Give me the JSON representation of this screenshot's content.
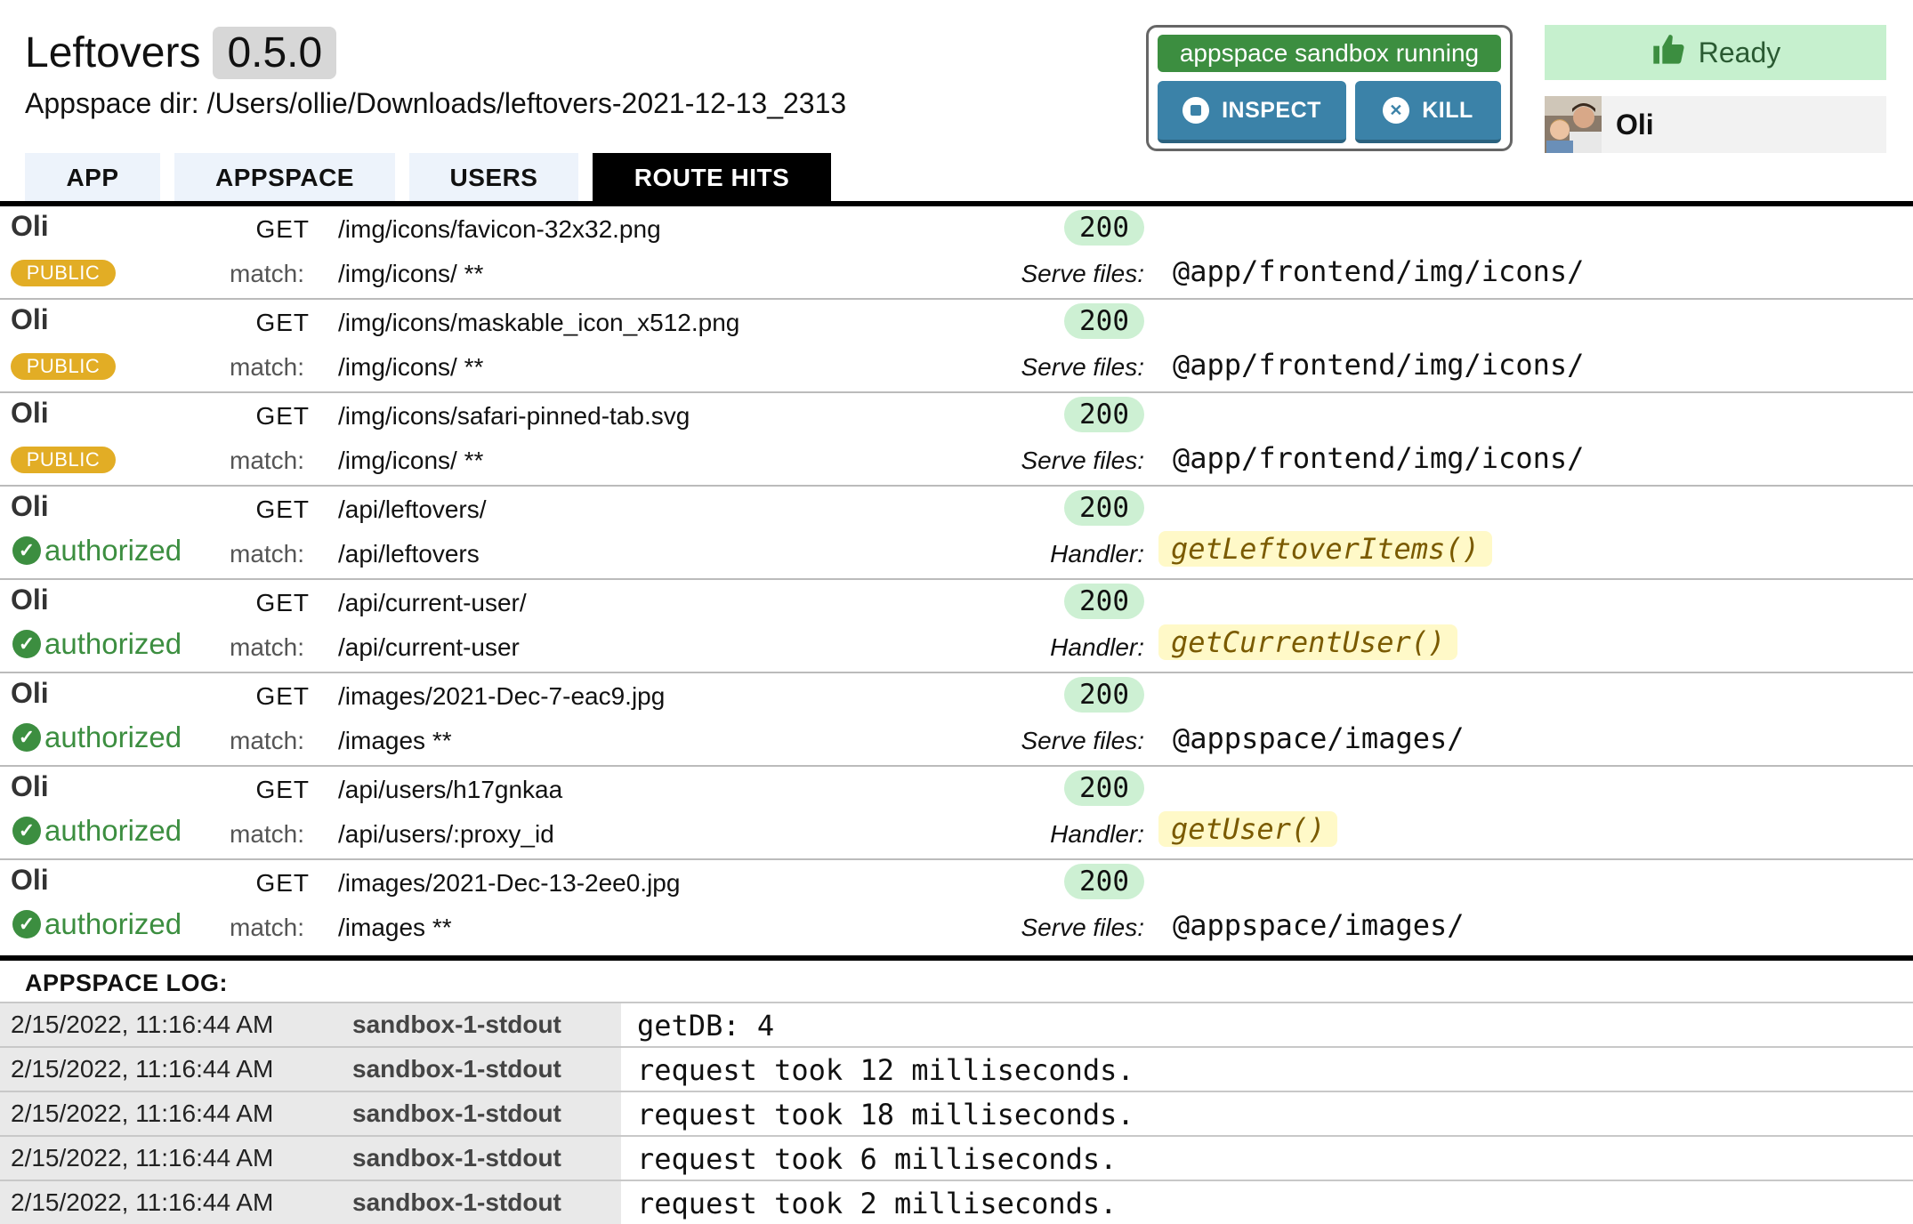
{
  "header": {
    "app_name": "Leftovers",
    "version": "0.5.0",
    "appspace_dir": "Appspace dir: /Users/ollie/Downloads/leftovers-2021-12-13_2313"
  },
  "sandbox": {
    "status": "appspace sandbox running",
    "inspect_label": "INSPECT",
    "kill_label": "KILL"
  },
  "ready": {
    "label": "Ready"
  },
  "user": {
    "name": "Oli"
  },
  "tabs": [
    {
      "label": "APP",
      "active": false
    },
    {
      "label": "APPSPACE",
      "active": false
    },
    {
      "label": "USERS",
      "active": false
    },
    {
      "label": "ROUTE HITS",
      "active": true
    }
  ],
  "route_hits": [
    {
      "user": "Oli",
      "method": "GET",
      "path": "/img/icons/favicon-32x32.png",
      "status": "200",
      "auth": "PUBLIC",
      "match_label": "match:",
      "match": "/img/icons/ **",
      "target_label": "Serve files:",
      "target": "@app/frontend/img/icons/"
    },
    {
      "user": "Oli",
      "method": "GET",
      "path": "/img/icons/maskable_icon_x512.png",
      "status": "200",
      "auth": "PUBLIC",
      "match_label": "match:",
      "match": "/img/icons/ **",
      "target_label": "Serve files:",
      "target": "@app/frontend/img/icons/"
    },
    {
      "user": "Oli",
      "method": "GET",
      "path": "/img/icons/safari-pinned-tab.svg",
      "status": "200",
      "auth": "PUBLIC",
      "match_label": "match:",
      "match": "/img/icons/ **",
      "target_label": "Serve files:",
      "target": "@app/frontend/img/icons/"
    },
    {
      "user": "Oli",
      "method": "GET",
      "path": "/api/leftovers/",
      "status": "200",
      "auth": "authorized",
      "match_label": "match:",
      "match": "/api/leftovers",
      "target_label": "Handler:",
      "target": "getLeftoverItems()"
    },
    {
      "user": "Oli",
      "method": "GET",
      "path": "/api/current-user/",
      "status": "200",
      "auth": "authorized",
      "match_label": "match:",
      "match": "/api/current-user",
      "target_label": "Handler:",
      "target": "getCurrentUser()"
    },
    {
      "user": "Oli",
      "method": "GET",
      "path": "/images/2021-Dec-7-eac9.jpg",
      "status": "200",
      "auth": "authorized",
      "match_label": "match:",
      "match": "/images **",
      "target_label": "Serve files:",
      "target": "@appspace/images/"
    },
    {
      "user": "Oli",
      "method": "GET",
      "path": "/api/users/h17gnkaa",
      "status": "200",
      "auth": "authorized",
      "match_label": "match:",
      "match": "/api/users/:proxy_id",
      "target_label": "Handler:",
      "target": "getUser()"
    },
    {
      "user": "Oli",
      "method": "GET",
      "path": "/images/2021-Dec-13-2ee0.jpg",
      "status": "200",
      "auth": "authorized",
      "match_label": "match:",
      "match": "/images **",
      "target_label": "Serve files:",
      "target": "@appspace/images/"
    }
  ],
  "log": {
    "title": "APPSPACE LOG:",
    "entries": [
      {
        "timestamp": "2/15/2022, 11:16:44 AM",
        "source": "sandbox-1-stdout",
        "message": "getDB: 4"
      },
      {
        "timestamp": "2/15/2022, 11:16:44 AM",
        "source": "sandbox-1-stdout",
        "message": "request took 12 milliseconds."
      },
      {
        "timestamp": "2/15/2022, 11:16:44 AM",
        "source": "sandbox-1-stdout",
        "message": "request took 18 milliseconds."
      },
      {
        "timestamp": "2/15/2022, 11:16:44 AM",
        "source": "sandbox-1-stdout",
        "message": "request took 6 milliseconds."
      },
      {
        "timestamp": "2/15/2022, 11:16:44 AM",
        "source": "sandbox-1-stdout",
        "message": "request took 2 milliseconds."
      }
    ]
  },
  "icons": {
    "ready": "thumbs-up-icon",
    "inspect": "stop-circle-icon",
    "kill": "x-circle-icon",
    "authorized": "check-circle-icon"
  },
  "colors": {
    "sandbox_running": "#3c8e40",
    "sandbox_button": "#3b82a8",
    "ready_bg": "#c6f0ce",
    "status_ok_bg": "#cdf0d3",
    "public_badge": "#e2ad25",
    "authorized": "#3c8e40",
    "handler_bg": "#fff9c8",
    "active_tab": "#000000",
    "tab_bg": "#edf3fb"
  }
}
